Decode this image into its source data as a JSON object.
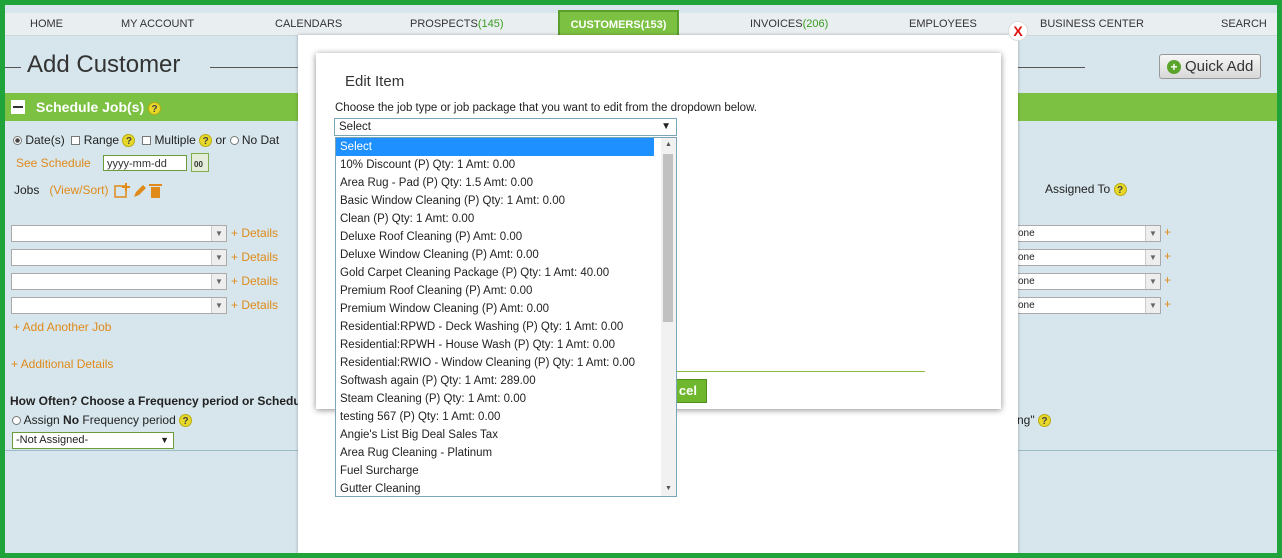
{
  "nav": {
    "home": "HOME",
    "my_account": "MY ACCOUNT",
    "calendars": "CALENDARS",
    "prospects": "PROSPECTS",
    "prospects_count": "(145)",
    "customers": "CUSTOMERS",
    "customers_count": "(153)",
    "invoices": "INVOICES",
    "invoices_count": "(206)",
    "employees": "EMPLOYEES",
    "business_center": "BUSINESS CENTER",
    "search": "SEARCH"
  },
  "header": {
    "title": "Add Customer",
    "quick_add": "Quick Add"
  },
  "schedule": {
    "title": "Schedule Job(s)",
    "help": "?",
    "dates_label": "Date(s)",
    "range_label": "Range",
    "multiple_label": "Multiple",
    "or_label": "or",
    "no_date_label": "No Dat",
    "see_schedule": "See Schedule",
    "date_placeholder": "yyyy-mm-dd",
    "cal_label": "00",
    "jobs_label": "Jobs",
    "view_sort": "(View/Sort)",
    "assigned_to": "Assigned To",
    "details_link": "+ Details",
    "assign_value": "one",
    "plus": "+",
    "add_another_job": "+ Add Another Job",
    "additional_details": "+ Additional Details",
    "how_often": "How Often? Choose a Frequency period or Schedule a",
    "assign_prefix": "Assign ",
    "assign_no": "No",
    "assign_suffix": " Frequency period",
    "not_assigned": "-Not Assigned-",
    "right_fragment": "ng\""
  },
  "modal": {
    "title": "Edit Item",
    "instruction": "Choose the job type or job package that you want to edit from the dropdown below.",
    "select_value": "Select",
    "cancel_fragment": "cel",
    "close": "X",
    "options": [
      "Select",
      "10% Discount (P) Qty: 1 Amt: 0.00",
      "Area Rug - Pad (P) Qty: 1.5 Amt: 0.00",
      "Basic Window Cleaning (P) Qty: 1 Amt: 0.00",
      "Clean (P) Qty: 1 Amt: 0.00",
      "Deluxe Roof Cleaning (P) Amt: 0.00",
      "Deluxe Window Cleaning (P) Amt: 0.00",
      "Gold Carpet Cleaning Package (P) Qty: 1 Amt: 40.00",
      "Premium Roof Cleaning (P) Amt: 0.00",
      "Premium Window Cleaning (P) Amt: 0.00",
      "Residential:RPWD - Deck Washing (P) Qty: 1 Amt: 0.00",
      "Residential:RPWH - House Wash (P) Qty: 1 Amt: 0.00",
      "Residential:RWIO - Window Cleaning (P) Qty: 1 Amt: 0.00",
      "Softwash again (P) Qty: 1 Amt: 289.00",
      "Steam Cleaning (P) Qty: 1 Amt: 0.00",
      "testing 567 (P) Qty: 1 Amt: 0.00",
      "Angie's List Big Deal Sales Tax",
      "Area Rug Cleaning - Platinum",
      "Fuel Surcharge",
      "Gutter Cleaning"
    ],
    "selected_index": 0
  },
  "colors": {
    "brand_green": "#7cc142",
    "frame_green": "#1fa33a",
    "selection_blue": "#1e90ff",
    "link_orange": "#e08a1a"
  }
}
